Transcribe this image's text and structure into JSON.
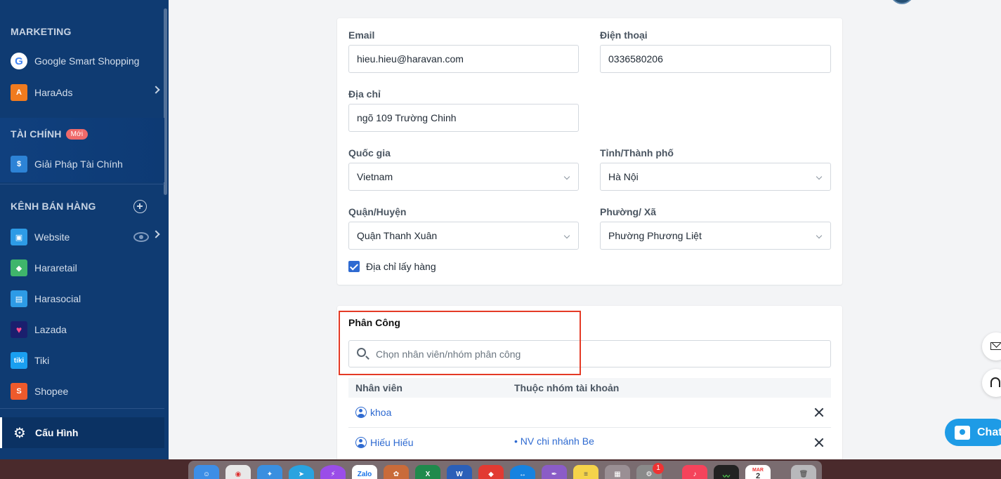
{
  "sidebar": {
    "marketing_header": "MARKETING",
    "items_marketing": [
      {
        "label": "Google Smart Shopping",
        "icon": "google-icon"
      },
      {
        "label": "HaraAds",
        "icon": "haraads-icon"
      }
    ],
    "finance_header": "TÀI CHÍNH",
    "finance_badge": "Mới",
    "finance_item": {
      "label": "Giải Pháp Tài Chính",
      "icon": "finance-icon"
    },
    "channels_header": "KÊNH BÁN HÀNG",
    "channels": [
      {
        "label": "Website",
        "icon": "website-icon"
      },
      {
        "label": "Hararetail",
        "icon": "hararetail-icon"
      },
      {
        "label": "Harasocial",
        "icon": "harasocial-icon"
      },
      {
        "label": "Lazada",
        "icon": "lazada-icon"
      },
      {
        "label": "Tiki",
        "icon": "tiki-icon"
      },
      {
        "label": "Shopee",
        "icon": "shopee-icon"
      }
    ],
    "config": {
      "label": "Cấu Hình",
      "icon": "gear-icon"
    }
  },
  "address_form": {
    "email_label": "Email",
    "email_value": "hieu.hieu@haravan.com",
    "phone_label": "Điện thoại",
    "phone_value": "0336580206",
    "address_label": "Địa chỉ",
    "address_value": "ngõ 109 Trường Chinh",
    "country_label": "Quốc gia",
    "country_value": "Vietnam",
    "province_label": "Tỉnh/Thành phố",
    "province_value": "Hà Nội",
    "district_label": "Quận/Huyện",
    "district_value": "Quận Thanh Xuân",
    "ward_label": "Phường/ Xã",
    "ward_value": "Phường Phương Liệt",
    "pickup_checkbox_label": "Địa chỉ lấy hàng",
    "pickup_checked": true
  },
  "assignment": {
    "title": "Phân Công",
    "search_placeholder": "Chọn nhân viên/nhóm phân công",
    "col_staff": "Nhân viên",
    "col_group": "Thuộc nhóm tài khoản",
    "rows": [
      {
        "staff": "khoa",
        "group": ""
      },
      {
        "staff": "Hiếu Hiếu",
        "group": "• NV chi nhánh Be"
      }
    ]
  },
  "floating": {
    "chat_label": "Chat",
    "mail_icon": "mail-icon",
    "support_icon": "headset-icon"
  },
  "dock": {
    "calendar_month": "MAR",
    "calendar_day": "2",
    "notification_count": "1",
    "apps": [
      "finder",
      "chrome",
      "safari",
      "telegram",
      "messenger",
      "zalo",
      "launcher",
      "excel",
      "word",
      "anydesk",
      "teamviewer",
      "quill",
      "notes",
      "launchpad",
      "system-preferences",
      "music",
      "activity-monitor",
      "calendar",
      "trash"
    ]
  },
  "colors": {
    "sidebar_bg": "#0f3b72",
    "accent": "#2e6ad1",
    "highlight": "#e43a25",
    "chat": "#1e9be6"
  }
}
